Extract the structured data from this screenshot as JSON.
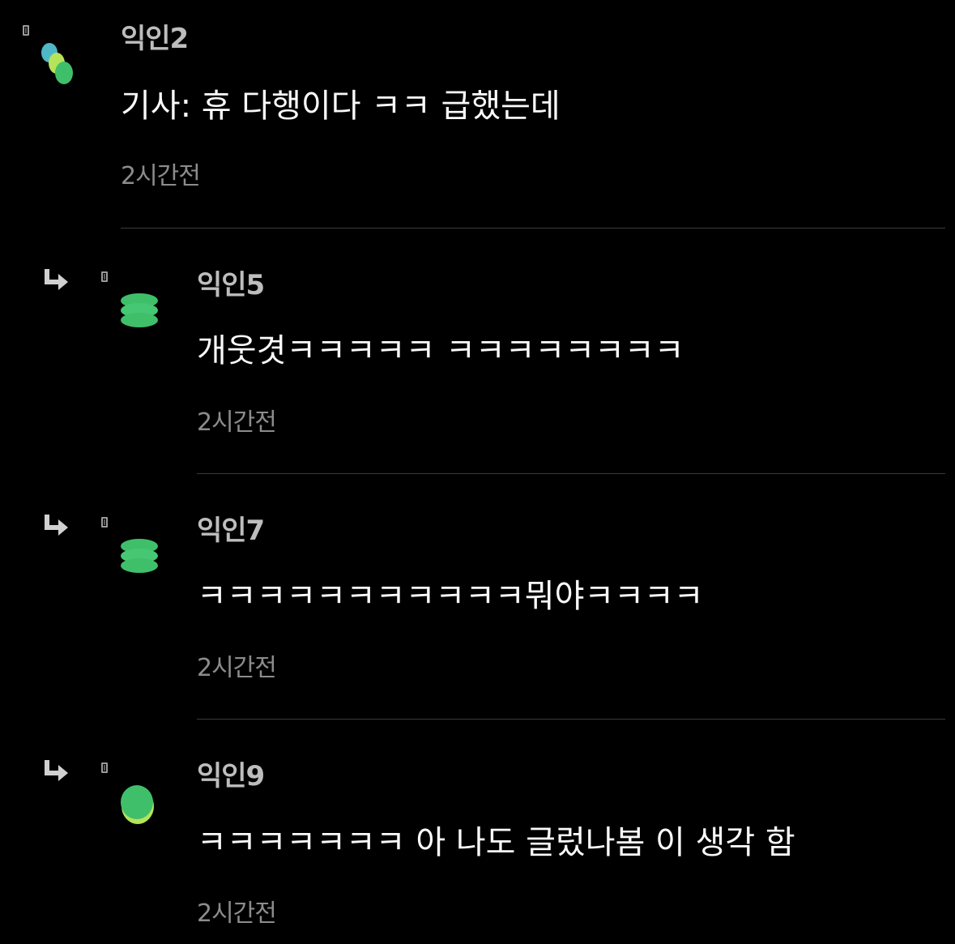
{
  "comments": [
    {
      "author": "익인2",
      "text": "기사: 휴 다행이다 ㅋㅋ 급했는데",
      "time": "2시간전",
      "is_reply": false
    },
    {
      "author": "익인5",
      "text": "개웃겻ㅋㅋㅋㅋㅋ ㅋㅋㅋㅋㅋㅋㅋㅋ",
      "time": "2시간전",
      "is_reply": true
    },
    {
      "author": "익인7",
      "text": "ㅋㅋㅋㅋㅋㅋㅋㅋㅋㅋㅋ뭐야ㅋㅋㅋㅋ",
      "time": "2시간전",
      "is_reply": true
    },
    {
      "author": "익인9",
      "text": "ㅋㅋㅋㅋㅋㅋㅋ 아 나도 글렀나봄 이 생각 함",
      "time": "2시간전",
      "is_reply": true
    }
  ],
  "icons": {
    "reply": "reply-arrow-icon",
    "checkbox": "checkbox-icon",
    "avatar": "avatar-blob-icon"
  },
  "colors": {
    "background": "#000000",
    "author": "#bdbdbd",
    "text": "#fafafa",
    "time": "#8c8c8c",
    "divider": "#3a3a3a",
    "avatar_green": "#3fbf6a",
    "avatar_light_green": "#9ee06a",
    "avatar_teal": "#4fb8c8"
  }
}
